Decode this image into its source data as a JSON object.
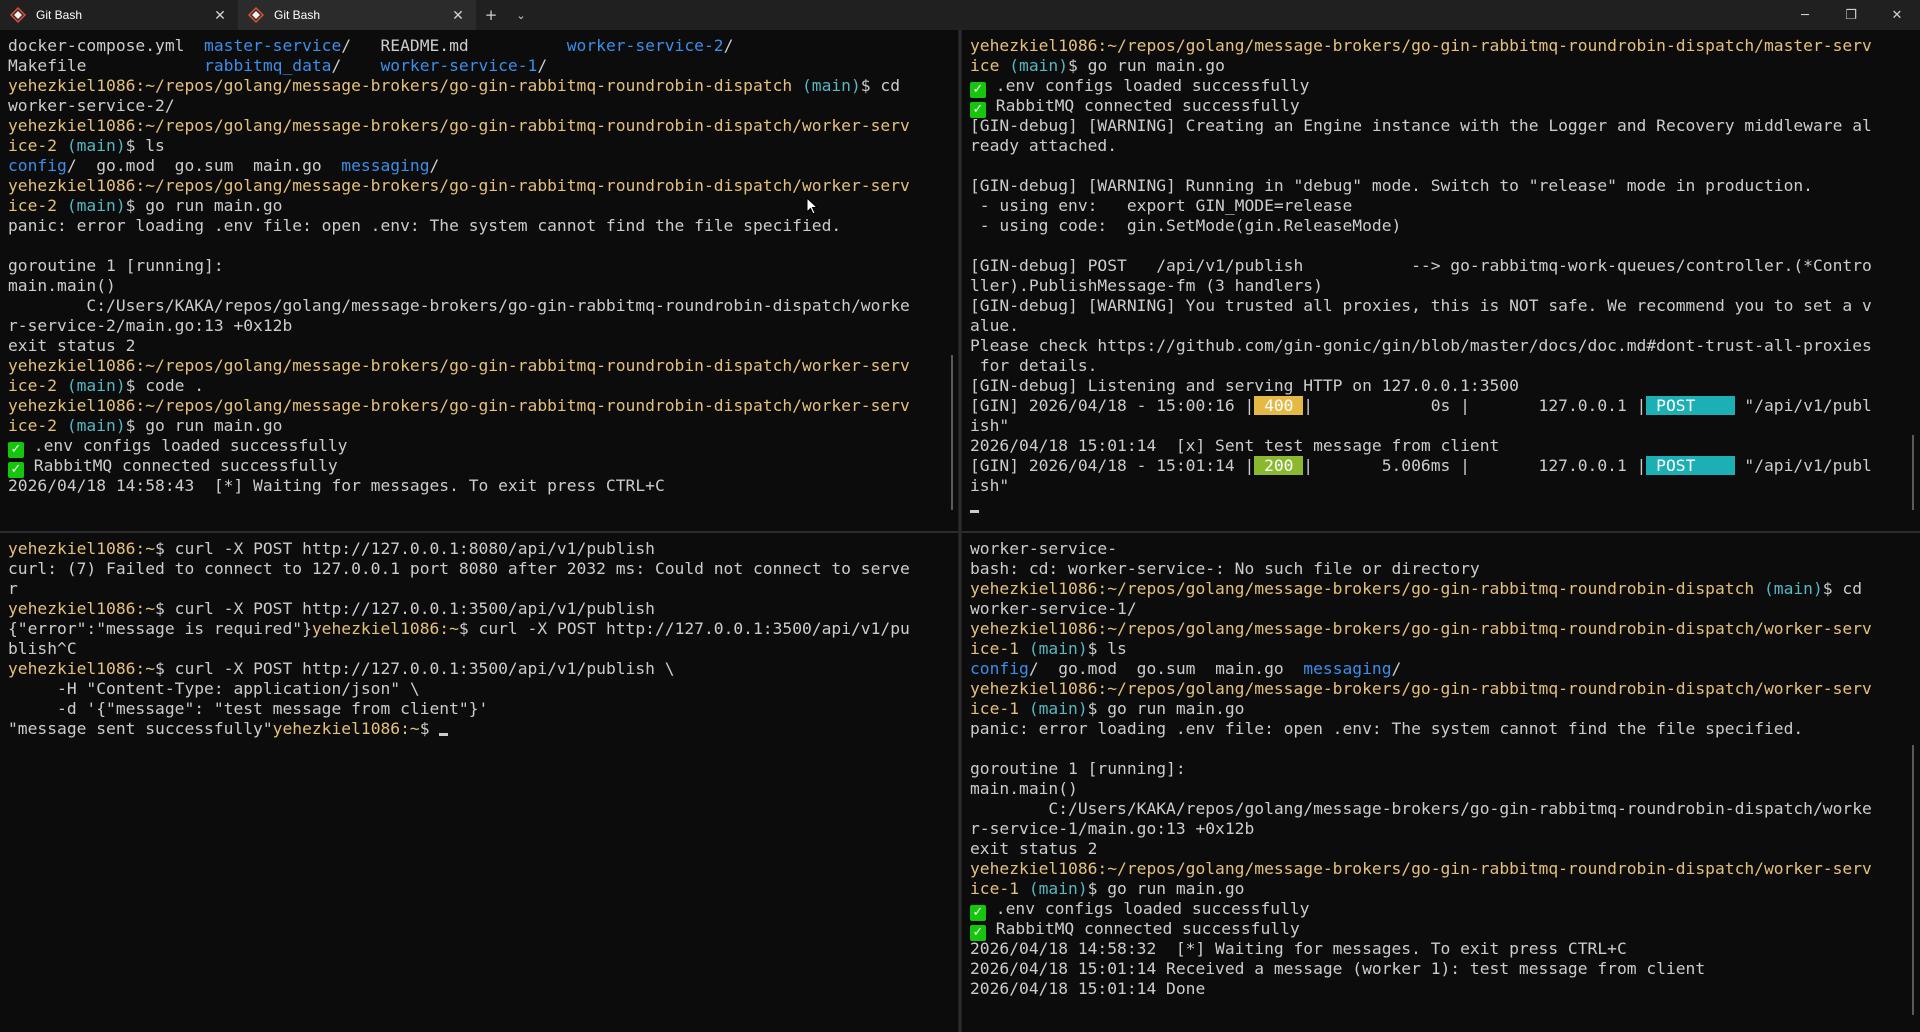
{
  "tabs": [
    {
      "title": "Git Bash",
      "close": "✕"
    },
    {
      "title": "Git Bash",
      "close": "✕"
    }
  ],
  "tabbar": {
    "new_tab": "+",
    "dropdown": "⌄"
  },
  "window": {
    "minimize": "─",
    "maximize": "❐",
    "close": "✕"
  },
  "colors": {
    "background": "#0c0c0c",
    "prompt": "#e5c07b",
    "branch": "#56b6c2",
    "directory": "#3b8eea",
    "status_400": "#e5b945",
    "status_200": "#8ab82f",
    "method": "#1cafb4",
    "check": "#16c60c"
  },
  "panes": {
    "top_left": [
      [
        {
          "t": "docker-compose.yml  "
        },
        {
          "t": "master-service",
          "c": "b"
        },
        {
          "t": "/   README.md          "
        },
        {
          "t": "worker-service-2",
          "c": "b"
        },
        {
          "t": "/"
        }
      ],
      [
        {
          "t": "Makefile            "
        },
        {
          "t": "rabbitmq_data",
          "c": "b"
        },
        {
          "t": "/    "
        },
        {
          "t": "worker-service-1",
          "c": "b"
        },
        {
          "t": "/"
        }
      ],
      [
        {
          "t": "yehezkiel1086:~/repos/golang/message-brokers/go-gin-rabbitmq-roundrobin-dispatch",
          "c": "y"
        },
        {
          "t": " (main)",
          "c": "c"
        },
        {
          "t": "$ cd"
        }
      ],
      [
        {
          "t": "worker-service-2/"
        }
      ],
      [
        {
          "t": "yehezkiel1086:~/repos/golang/message-brokers/go-gin-rabbitmq-roundrobin-dispatch/worker-serv",
          "c": "y"
        }
      ],
      [
        {
          "t": "ice-2",
          "c": "y"
        },
        {
          "t": " (main)",
          "c": "c"
        },
        {
          "t": "$ ls"
        }
      ],
      [
        {
          "t": "config",
          "c": "b"
        },
        {
          "t": "/  go.mod  go.sum  main.go  "
        },
        {
          "t": "messaging",
          "c": "b"
        },
        {
          "t": "/"
        }
      ],
      [
        {
          "t": "yehezkiel1086:~/repos/golang/message-brokers/go-gin-rabbitmq-roundrobin-dispatch/worker-serv",
          "c": "y"
        }
      ],
      [
        {
          "t": "ice-2",
          "c": "y"
        },
        {
          "t": " (main)",
          "c": "c"
        },
        {
          "t": "$ go run main.go"
        }
      ],
      [
        {
          "t": "panic: error loading .env file: open .env: The system cannot find the file specified."
        }
      ],
      [
        {
          "t": ""
        }
      ],
      [
        {
          "t": "goroutine 1 [running]:"
        }
      ],
      [
        {
          "t": "main.main()"
        }
      ],
      [
        {
          "t": "        C:/Users/KAKA/repos/golang/message-brokers/go-gin-rabbitmq-roundrobin-dispatch/worke"
        }
      ],
      [
        {
          "t": "r-service-2/main.go:13 +0x12b"
        }
      ],
      [
        {
          "t": "exit status 2"
        }
      ],
      [
        {
          "t": "yehezkiel1086:~/repos/golang/message-brokers/go-gin-rabbitmq-roundrobin-dispatch/worker-serv",
          "c": "y"
        }
      ],
      [
        {
          "t": "ice-2",
          "c": "y"
        },
        {
          "t": " (main)",
          "c": "c"
        },
        {
          "t": "$ code ."
        }
      ],
      [
        {
          "t": "yehezkiel1086:~/repos/golang/message-brokers/go-gin-rabbitmq-roundrobin-dispatch/worker-serv",
          "c": "y"
        }
      ],
      [
        {
          "t": "ice-2",
          "c": "y"
        },
        {
          "t": " (main)",
          "c": "c"
        },
        {
          "t": "$ go run main.go"
        }
      ],
      [
        {
          "t": "✓",
          "c": "check"
        },
        {
          "t": " .env configs loaded successfully"
        }
      ],
      [
        {
          "t": "✓",
          "c": "check"
        },
        {
          "t": " RabbitMQ connected successfully"
        }
      ],
      [
        {
          "t": "2026/04/18 14:58:43  [*] Waiting for messages. To exit press CTRL+C"
        }
      ]
    ],
    "bottom_left": [
      [
        {
          "t": "yehezkiel1086:~",
          "c": "y"
        },
        {
          "t": "$ curl -X POST http://127.0.0.1:8080/api/v1/publish"
        }
      ],
      [
        {
          "t": "curl: (7) Failed to connect to 127.0.0.1 port 8080 after 2032 ms: Could not connect to serve"
        }
      ],
      [
        {
          "t": "r"
        }
      ],
      [
        {
          "t": "yehezkiel1086:~",
          "c": "y"
        },
        {
          "t": "$ curl -X POST http://127.0.0.1:3500/api/v1/publish"
        }
      ],
      [
        {
          "t": "{\"error\":\"message is required\"}"
        },
        {
          "t": "yehezkiel1086:~",
          "c": "y"
        },
        {
          "t": "$ curl -X POST http://127.0.0.1:3500/api/v1/pu"
        }
      ],
      [
        {
          "t": "blish^C"
        }
      ],
      [
        {
          "t": "yehezkiel1086:~",
          "c": "y"
        },
        {
          "t": "$ curl -X POST http://127.0.0.1:3500/api/v1/publish \\"
        }
      ],
      [
        {
          "t": "     -H \"Content-Type: application/json\" \\"
        }
      ],
      [
        {
          "t": "     -d '{\"message\": \"test message from client\"}'"
        }
      ],
      [
        {
          "t": "\"message sent successfully\""
        },
        {
          "t": "yehezkiel1086:~",
          "c": "y"
        },
        {
          "t": "$ "
        },
        {
          "t": "",
          "c": "cursor"
        }
      ]
    ],
    "top_right": [
      [
        {
          "t": "yehezkiel1086:~/repos/golang/message-brokers/go-gin-rabbitmq-roundrobin-dispatch/master-serv",
          "c": "y"
        }
      ],
      [
        {
          "t": "ice",
          "c": "y"
        },
        {
          "t": " (main)",
          "c": "c"
        },
        {
          "t": "$ go run main.go"
        }
      ],
      [
        {
          "t": "✓",
          "c": "check"
        },
        {
          "t": " .env configs loaded successfully"
        }
      ],
      [
        {
          "t": "✓",
          "c": "check"
        },
        {
          "t": " RabbitMQ connected successfully"
        }
      ],
      [
        {
          "t": "[GIN-debug] [WARNING] Creating an Engine instance with the Logger and Recovery middleware al"
        }
      ],
      [
        {
          "t": "ready attached."
        }
      ],
      [
        {
          "t": ""
        }
      ],
      [
        {
          "t": "[GIN-debug] [WARNING] Running in \"debug\" mode. Switch to \"release\" mode in production."
        }
      ],
      [
        {
          "t": " - using env:   export GIN_MODE=release"
        }
      ],
      [
        {
          "t": " - using code:  gin.SetMode(gin.ReleaseMode)"
        }
      ],
      [
        {
          "t": ""
        }
      ],
      [
        {
          "t": "[GIN-debug] POST   /api/v1/publish           --> go-rabbitmq-work-queues/controller.(*Contro"
        }
      ],
      [
        {
          "t": "ller).PublishMessage-fm (3 handlers)"
        }
      ],
      [
        {
          "t": "[GIN-debug] [WARNING] You trusted all proxies, this is NOT safe. We recommend you to set a v"
        }
      ],
      [
        {
          "t": "alue."
        }
      ],
      [
        {
          "t": "Please check https://github.com/gin-gonic/gin/blob/master/docs/doc.md#dont-trust-all-proxies"
        }
      ],
      [
        {
          "t": " for details."
        }
      ],
      [
        {
          "t": "[GIN-debug] Listening and serving HTTP on 127.0.0.1:3500"
        }
      ],
      [
        {
          "t": "[GIN] 2026/04/18 - 15:00:16 |"
        },
        {
          "t": " 400 ",
          "c": "b400"
        },
        {
          "t": "|            0s |       127.0.0.1 |"
        },
        {
          "t": " POST    ",
          "c": "bpost"
        },
        {
          "t": " \"/api/v1/publ"
        }
      ],
      [
        {
          "t": "ish\""
        }
      ],
      [
        {
          "t": "2026/04/18 15:01:14  [x] Sent test message from client"
        }
      ],
      [
        {
          "t": "[GIN] 2026/04/18 - 15:01:14 |"
        },
        {
          "t": " 200 ",
          "c": "b200"
        },
        {
          "t": "|       5.006ms |       127.0.0.1 |"
        },
        {
          "t": " POST    ",
          "c": "bpost"
        },
        {
          "t": " \"/api/v1/publ"
        }
      ],
      [
        {
          "t": "ish\""
        }
      ],
      [
        {
          "t": "",
          "c": "cursor"
        }
      ]
    ],
    "bottom_right": [
      [
        {
          "t": "worker-service-"
        }
      ],
      [
        {
          "t": "bash: cd: worker-service-: No such file or directory"
        }
      ],
      [
        {
          "t": "yehezkiel1086:~/repos/golang/message-brokers/go-gin-rabbitmq-roundrobin-dispatch",
          "c": "y"
        },
        {
          "t": " (main)",
          "c": "c"
        },
        {
          "t": "$ cd"
        }
      ],
      [
        {
          "t": "worker-service-1/"
        }
      ],
      [
        {
          "t": "yehezkiel1086:~/repos/golang/message-brokers/go-gin-rabbitmq-roundrobin-dispatch/worker-serv",
          "c": "y"
        }
      ],
      [
        {
          "t": "ice-1",
          "c": "y"
        },
        {
          "t": " (main)",
          "c": "c"
        },
        {
          "t": "$ ls"
        }
      ],
      [
        {
          "t": "config",
          "c": "b"
        },
        {
          "t": "/  go.mod  go.sum  main.go  "
        },
        {
          "t": "messaging",
          "c": "b"
        },
        {
          "t": "/"
        }
      ],
      [
        {
          "t": "yehezkiel1086:~/repos/golang/message-brokers/go-gin-rabbitmq-roundrobin-dispatch/worker-serv",
          "c": "y"
        }
      ],
      [
        {
          "t": "ice-1",
          "c": "y"
        },
        {
          "t": " (main)",
          "c": "c"
        },
        {
          "t": "$ go run main.go"
        }
      ],
      [
        {
          "t": "panic: error loading .env file: open .env: The system cannot find the file specified."
        }
      ],
      [
        {
          "t": ""
        }
      ],
      [
        {
          "t": "goroutine 1 [running]:"
        }
      ],
      [
        {
          "t": "main.main()"
        }
      ],
      [
        {
          "t": "        C:/Users/KAKA/repos/golang/message-brokers/go-gin-rabbitmq-roundrobin-dispatch/worke"
        }
      ],
      [
        {
          "t": "r-service-1/main.go:13 +0x12b"
        }
      ],
      [
        {
          "t": "exit status 2"
        }
      ],
      [
        {
          "t": "yehezkiel1086:~/repos/golang/message-brokers/go-gin-rabbitmq-roundrobin-dispatch/worker-serv",
          "c": "y"
        }
      ],
      [
        {
          "t": "ice-1",
          "c": "y"
        },
        {
          "t": " (main)",
          "c": "c"
        },
        {
          "t": "$ go run main.go"
        }
      ],
      [
        {
          "t": "✓",
          "c": "check"
        },
        {
          "t": " .env configs loaded successfully"
        }
      ],
      [
        {
          "t": "✓",
          "c": "check"
        },
        {
          "t": " RabbitMQ connected successfully"
        }
      ],
      [
        {
          "t": "2026/04/18 14:58:32  [*] Waiting for messages. To exit press CTRL+C"
        }
      ],
      [
        {
          "t": "2026/04/18 15:01:14 Received a message (worker 1): test message from client"
        }
      ],
      [
        {
          "t": "2026/04/18 15:01:14 Done"
        }
      ],
      [
        {
          "t": ""
        }
      ],
      [
        {
          "t": "",
          "c": "cursor"
        }
      ]
    ]
  }
}
